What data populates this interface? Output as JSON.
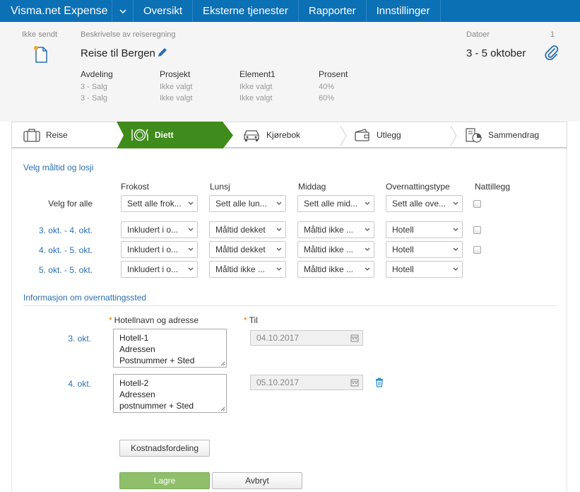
{
  "nav": {
    "brand": "Visma.net Expense",
    "items": [
      "Oversikt",
      "Eksterne tjenester",
      "Rapporter",
      "Innstillinger"
    ]
  },
  "header": {
    "status_label": "Ikke sendt",
    "desc_label": "Beskrivelse av reiseregning",
    "title": "Reise til Bergen",
    "dates_label": "Datoer",
    "dates_value": "3 - 5 oktober",
    "attachment_count": "1",
    "dimensions": [
      {
        "header": "Avdeling",
        "values": [
          "3 - Salg",
          "3 - Salg"
        ]
      },
      {
        "header": "Prosjekt",
        "values": [
          "Ikke valgt",
          "Ikke valgt"
        ]
      },
      {
        "header": "Element1",
        "values": [
          "Ikke valgt",
          "Ikke valgt"
        ]
      },
      {
        "header": "Prosent",
        "values": [
          "40%",
          "60%"
        ]
      }
    ]
  },
  "steps": [
    {
      "label": "Reise",
      "icon": "suitcase-icon"
    },
    {
      "label": "Diett",
      "icon": "plate-cutlery-icon",
      "active": true
    },
    {
      "label": "Kjørebok",
      "icon": "car-icon"
    },
    {
      "label": "Utlegg",
      "icon": "wallet-icon"
    },
    {
      "label": "Sammendrag",
      "icon": "summary-chart-icon"
    }
  ],
  "meals": {
    "section_title": "Velg måltid og losji",
    "columns": [
      "Frokost",
      "Lunsj",
      "Middag",
      "Overnattingstype",
      "Nattillegg"
    ],
    "all_row": {
      "label": "Velg for alle",
      "values": [
        "Sett alle frok...",
        "Sett alle lun...",
        "Sett alle mid...",
        "Sett alle ove..."
      ]
    },
    "rows": [
      {
        "label": "3. okt. - 4. okt.",
        "values": [
          "Inkludert i o...",
          "Måltid dekket",
          "Måltid ikke ...",
          "Hotell"
        ]
      },
      {
        "label": "4. okt. - 5. okt.",
        "values": [
          "Inkludert i o...",
          "Måltid dekket",
          "Måltid ikke ...",
          "Hotell"
        ]
      },
      {
        "label": "5. okt. - 5. okt.",
        "values": [
          "Inkludert i o...",
          "Måltid ikke ...",
          "Måltid ikke ...",
          "Hotell"
        ]
      }
    ]
  },
  "lodging": {
    "section_title": "Informasjon om overnattingssted",
    "required_mark": "*",
    "hotel_label": "Hotellnavn og adresse",
    "to_label": "Til",
    "entries": [
      {
        "day": "3. okt.",
        "lines": [
          "Hotell-1",
          "Adressen",
          "Postnummer + Sted"
        ],
        "date": "04.10.2017"
      },
      {
        "day": "4. okt.",
        "lines": [
          "Hotell-2",
          "Adressen",
          "postnummer + Sted"
        ],
        "date": "05.10.2017"
      }
    ]
  },
  "buttons": {
    "cost_allocation": "Kostnadsfordeling",
    "save": "Lagre",
    "cancel": "Avbryt"
  },
  "colors": {
    "nav_bg": "#0c70b5",
    "active_step": "#3f8b1b",
    "link_blue": "#2a6fb0",
    "save_green": "#8fbf6a"
  }
}
